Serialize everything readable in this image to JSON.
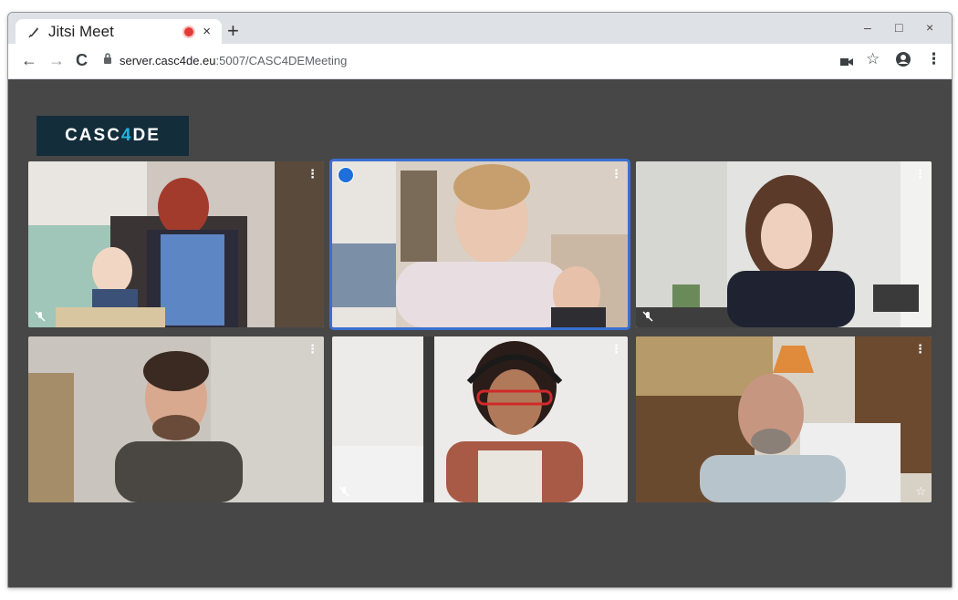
{
  "browser": {
    "tab_title": "Jitsi Meet",
    "tab_close": "×",
    "new_tab": "+",
    "minimize": "–",
    "maximize": "□",
    "close": "×",
    "nav_back": "←",
    "nav_forward": "→",
    "nav_reload": "C",
    "url_host": "server.casc4de.eu",
    "url_path": ":5007/CASC4DEMeeting",
    "menu": "⋮",
    "bookmark": "☆"
  },
  "logo": {
    "part1": "CASC",
    "part2": "4",
    "part3": "DE"
  },
  "participants": [
    {
      "muted": true,
      "active_speaker": false,
      "moderator": false
    },
    {
      "muted": false,
      "active_speaker": true,
      "moderator": false
    },
    {
      "muted": true,
      "active_speaker": false,
      "moderator": false
    },
    {
      "muted": false,
      "active_speaker": false,
      "moderator": false
    },
    {
      "muted": true,
      "active_speaker": false,
      "moderator": false
    },
    {
      "muted": false,
      "active_speaker": false,
      "moderator": true
    }
  ],
  "tile_menu_glyph": "⋮",
  "star_glyph": "☆",
  "colors": {
    "meeting_bg": "#474747",
    "logo_bg": "#132d3b",
    "logo_accent": "#1fb6e0",
    "active_border": "#3a6fd0"
  }
}
